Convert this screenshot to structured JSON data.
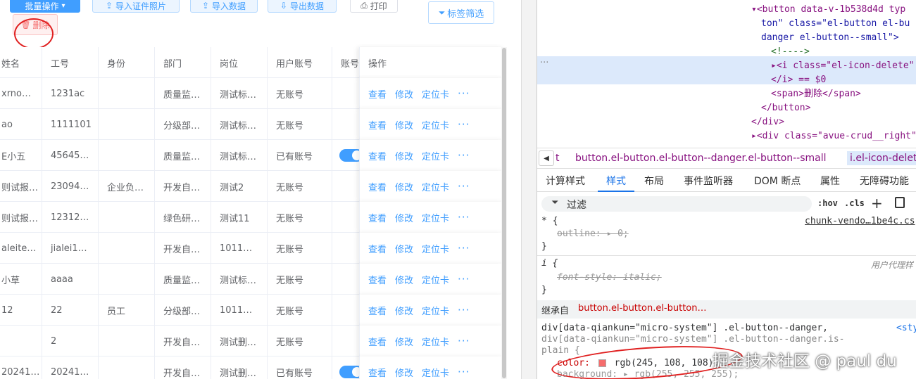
{
  "toolbar": {
    "batch_label": "批量操作",
    "import_photos_label": "导入证件照片",
    "import_data_label": "导入数据",
    "export_data_label": "导出数据",
    "print_label": "打印",
    "delete_label": "删除",
    "tag_filter_label": "标签筛选"
  },
  "table": {
    "headers": [
      "姓名",
      "工号",
      "身份",
      "部门",
      "岗位",
      "用户账号",
      "账号"
    ],
    "ops_header": "操作",
    "op_labels": {
      "view": "查看",
      "edit": "修改",
      "locate": "定位卡",
      "more": "···"
    },
    "rows": [
      [
        "xrno…",
        "1231ac",
        "",
        "质量监…",
        "测试标…",
        "无账号",
        ""
      ],
      [
        "ao",
        "1111101",
        "",
        "分级部…",
        "测试标…",
        "无账号",
        ""
      ],
      [
        "E小五",
        "45645…",
        "",
        "质量监…",
        "测试标…",
        "已有账号",
        "toggle"
      ],
      [
        "则试报…",
        "23094…",
        "企业负…",
        "开发自…",
        "测试2",
        "无账号",
        ""
      ],
      [
        "则试报…",
        "12312…",
        "",
        "绿色研…",
        "测试11",
        "无账号",
        ""
      ],
      [
        "aleite…",
        "jialei1…",
        "",
        "开发自…",
        "1011…",
        "无账号",
        ""
      ],
      [
        "小草",
        "aaaa",
        "",
        "质量监…",
        "测试标…",
        "无账号",
        ""
      ],
      [
        "12",
        "22",
        "员工",
        "分级部…",
        "1011…",
        "无账号",
        ""
      ],
      [
        "",
        "2",
        "",
        "开发自…",
        "测试删…",
        "无账号",
        ""
      ],
      [
        "20241…",
        "20241…",
        "",
        "开发自…",
        "测试删…",
        "已有账号",
        "toggle"
      ]
    ]
  },
  "devtools": {
    "dom_lines": [
      {
        "indent": 0,
        "html": "▾<button data-v-1b538d4d typ"
      },
      {
        "indent": 1,
        "html": "ton\" class=\"el-button el-bu"
      },
      {
        "indent": 1,
        "html": "danger el-button--small\">"
      },
      {
        "indent": 2,
        "html": "<!---->"
      },
      {
        "indent": 2,
        "html": "▸<i class=\"el-icon-delete\""
      },
      {
        "indent": 2,
        "html": "</i> == $0"
      },
      {
        "indent": 2,
        "html": "<span>删除</span>"
      },
      {
        "indent": 1,
        "html": "</button>"
      },
      {
        "indent": 0,
        "html": "</div>"
      },
      {
        "indent": 0,
        "html": "▸<div class=\"avue-crud__right\""
      }
    ],
    "gutter_dots": "···",
    "crumbs": [
      "t",
      "button.el-button.el-button--danger.el-button--small",
      "i.el-icon-delet"
    ],
    "tabs": [
      "计算样式",
      "样式",
      "布局",
      "事件监听器",
      "DOM 断点",
      "属性",
      "无障碍功能"
    ],
    "filter_label": "过滤",
    "hov_label": ":hov",
    "cls_label": ".cls",
    "plus_label": "+",
    "rules": {
      "r1_selector": "* {",
      "r1_source": "chunk-vendo…1be4c.cs",
      "r1_prop": "outline: ▸ 0;",
      "r1_close": "}",
      "r2_selector": "i {",
      "r2_source": "用户代理样",
      "r2_prop": "font-style: italic;",
      "r2_close": "}",
      "inherit_label": "继承自",
      "inherit_target": "button.el-button.el-button…",
      "r3_sel1": "div[data-qiankun=\"micro-system\"] .el-button--danger,",
      "r3_sel2": "div[data-qiankun=\"micro-system\"] .el-button--danger.is-",
      "r3_sel3": "plain {",
      "r3_source": "<sty",
      "r3_color_name": "color:",
      "r3_color_value": "rgb(245, 108, 108);",
      "r3_bg": "background: ▸ rgb(255, 255, 255);"
    }
  },
  "watermark": "掘金技术社区 @ paul du",
  "colors": {
    "primary": "#409eff",
    "danger": "#f56c6c",
    "annotation": "#e02020"
  }
}
